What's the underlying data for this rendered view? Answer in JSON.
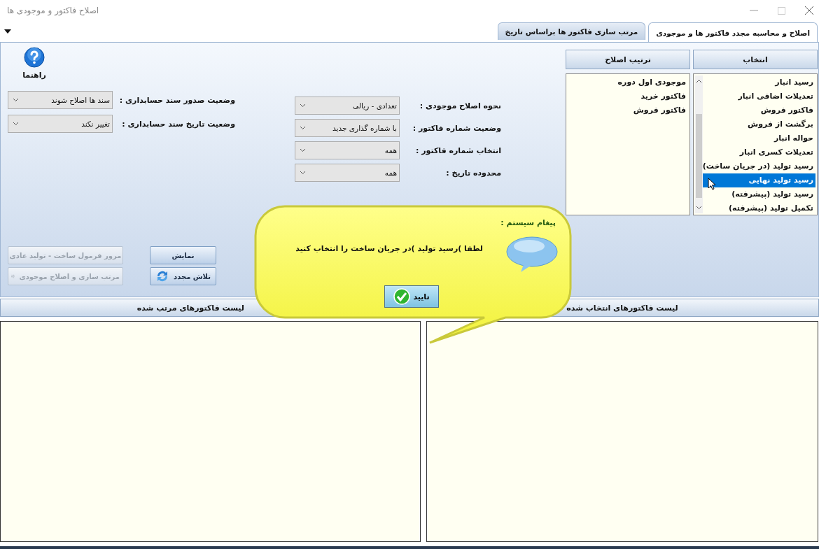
{
  "window": {
    "title": "اصلاح فاکتور و موجودی ها"
  },
  "tabs": [
    {
      "label": "اصلاح و محاسبه مجدد فاکتور ها و موجودی",
      "selected": true
    },
    {
      "label": "مرتب سازی فاکتور ها براساس تاریخ",
      "selected": false
    }
  ],
  "help": {
    "label": "راهنما"
  },
  "selection_list": {
    "header": "انتخاب",
    "items": [
      {
        "label": "رسید انبار",
        "selected": false
      },
      {
        "label": "تعدیلات اضافی انبار",
        "selected": false
      },
      {
        "label": "فاکتور فروش",
        "selected": false
      },
      {
        "label": "برگشت از فروش",
        "selected": false
      },
      {
        "label": "حواله انبار",
        "selected": false
      },
      {
        "label": "تعدیلات کسری انبار",
        "selected": false
      },
      {
        "label": "رسید تولید (در جریان ساخت)",
        "selected": false
      },
      {
        "label": "رسید تولید نهایی",
        "selected": true
      },
      {
        "label": "رسید تولید (پیشرفته)",
        "selected": false
      },
      {
        "label": "تکمیل تولید (پیشرفته)",
        "selected": false
      }
    ]
  },
  "order_list": {
    "header": "ترتیب اصلاح",
    "items": [
      "موجودی اول دوره",
      "فاکتور خرید",
      "فاکتور فروش"
    ]
  },
  "form_fields": [
    {
      "label": "نحوه اصلاح موجودی :",
      "value": "تعدادی - ریالی"
    },
    {
      "label": "وضعیت شماره فاکتور :",
      "value": "با شماره گذاری جدید"
    },
    {
      "label": "انتخاب شماره فاکتور :",
      "value": "همه"
    },
    {
      "label": "محدوده تاریخ :",
      "value": "همه"
    }
  ],
  "accounting_fields": [
    {
      "label": "وضعیت صدور سند حسابداری :",
      "value": "سند ها اصلاح شوند"
    },
    {
      "label": "وضعیت تاریخ سند حسابداری :",
      "value": "تغییر نکند"
    }
  ],
  "buttons": [
    {
      "label": "نمایش",
      "disabled": false,
      "kind": "plain"
    },
    {
      "label": "مرور فرمول ساخت - تولید عادی",
      "disabled": true,
      "kind": "plain"
    },
    {
      "label": "تلاش مجدد",
      "disabled": false,
      "kind": "refresh"
    },
    {
      "label": "مرتب سازی و اصلاح موجودی",
      "disabled": true,
      "kind": "sort"
    }
  ],
  "panels": [
    {
      "header": "لیست فاکتورهای انتخاب شده"
    },
    {
      "header": "لیست فاکتورهای مرتب شده"
    }
  ],
  "dialog": {
    "title": "پیغام سیستم :",
    "message": "لطفا )رسید تولید )در جریان ساخت را انتخاب کنید",
    "button": "تایید"
  }
}
